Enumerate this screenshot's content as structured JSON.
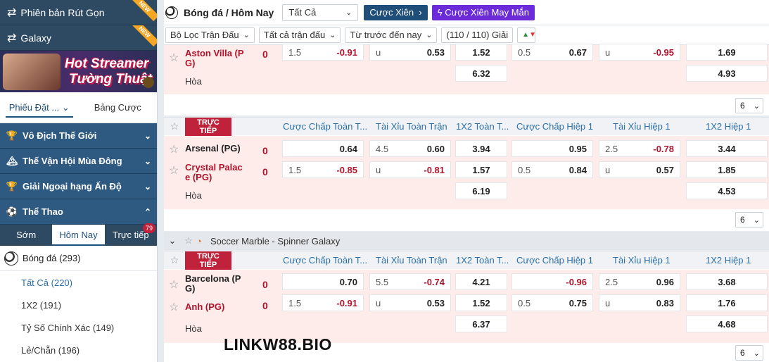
{
  "sidebar": {
    "top1": "Phiên bản Rút Gọn",
    "top2": "Galaxy",
    "new_tag": "NEW",
    "banner_line1": "Hot Streamer",
    "banner_line2": "Tường Thuật",
    "tabs": [
      "Phiếu Đặt ...",
      "Bảng Cược"
    ],
    "categories": [
      "Vô Địch Thế Giới",
      "Thế Vận Hội Mùa Đông",
      "Giải Ngoại hạng Ấn Độ",
      "Thể Thao"
    ],
    "subtabs": [
      "Sớm",
      "Hôm Nay",
      "Trực tiếp"
    ],
    "live_count": "79",
    "sport_name": "Bóng đá",
    "sport_count": "(293)",
    "subitems": [
      {
        "label": "Tất Cả",
        "count": "(220)"
      },
      {
        "label": "1X2",
        "count": "(191)"
      },
      {
        "label": "Tỷ Số Chính Xác",
        "count": "(149)"
      },
      {
        "label": "Lẻ/Chẵn",
        "count": "(196)"
      }
    ]
  },
  "header": {
    "title": "Bóng đá / Hôm Nay",
    "filter_value": "Tất Cả",
    "btn_xien": "Cược Xiên",
    "btn_may_man": "Cược Xiên May Mắn"
  },
  "filters": {
    "f1": "Bộ Lọc Trận Đấu",
    "f2": "Tất cả trận đấu",
    "f3": "Từ trước đến nay",
    "f4": "(110 / 110) Giải"
  },
  "columns": [
    "Cược Chấp Toàn T...",
    "Tài Xỉu Toàn Trận",
    "1X2 Toàn T...",
    "Cược Chấp Hiệp 1",
    "Tài Xỉu Hiệp 1",
    "1X2 Hiệp 1"
  ],
  "live_label": "TRỰC TIẾP",
  "draw_label": "Hòa",
  "more_value": "6",
  "league2": "Soccer Marble - Spinner Galaxy",
  "match0": {
    "team2": "Aston Villa (P G)",
    "score2": "0",
    "r2": {
      "hdp_l": "1.5",
      "hdp_v": "-0.91",
      "ou_l": "u",
      "ou_v": "0.53",
      "x12": "1.52",
      "h_hdp_l": "0.5",
      "h_hdp_v": "0.67",
      "h_ou_l": "u",
      "h_ou_v": "-0.95",
      "h_x12": "1.69"
    },
    "draw_x12": "6.32",
    "draw_hx12": "4.93"
  },
  "match1": {
    "team1": "Arsenal (PG)",
    "score1": "0",
    "team2": "Crystal Palac e (PG)",
    "score2": "0",
    "r1": {
      "hdp_v": "0.64",
      "ou_l": "4.5",
      "ou_v": "0.60",
      "x12": "3.94",
      "h_hdp_v": "0.95",
      "h_ou_l": "2.5",
      "h_ou_v": "-0.78",
      "h_x12": "3.44"
    },
    "r2": {
      "hdp_l": "1.5",
      "hdp_v": "-0.85",
      "ou_l": "u",
      "ou_v": "-0.81",
      "x12": "1.57",
      "h_hdp_l": "0.5",
      "h_hdp_v": "0.84",
      "h_ou_l": "u",
      "h_ou_v": "0.57",
      "h_x12": "1.85"
    },
    "draw_x12": "6.19",
    "draw_hx12": "4.53"
  },
  "match2": {
    "team1": "Barcelona (P G)",
    "score1": "0",
    "team2": "Anh (PG)",
    "score2": "0",
    "r1": {
      "hdp_v": "0.70",
      "ou_l": "5.5",
      "ou_v": "-0.74",
      "x12": "4.21",
      "h_hdp_v": "-0.96",
      "h_ou_l": "2.5",
      "h_ou_v": "0.96",
      "h_x12": "3.68"
    },
    "r2": {
      "hdp_l": "1.5",
      "hdp_v": "-0.91",
      "ou_l": "u",
      "ou_v": "0.53",
      "x12": "1.52",
      "h_hdp_l": "0.5",
      "h_hdp_v": "0.75",
      "h_ou_l": "u",
      "h_ou_v": "0.83",
      "h_x12": "1.76"
    },
    "draw_x12": "6.37",
    "draw_hx12": "4.68"
  },
  "watermark": "LINKW88.BIO"
}
